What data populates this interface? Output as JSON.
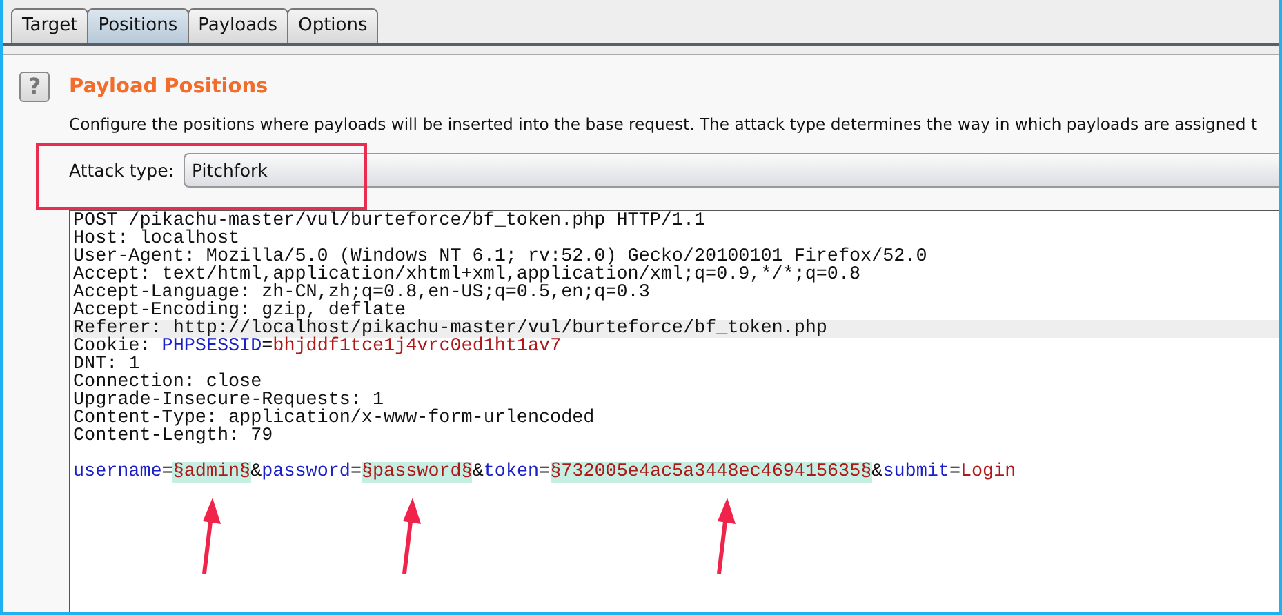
{
  "tabs": [
    {
      "label": "Target",
      "selected": false
    },
    {
      "label": "Positions",
      "selected": true
    },
    {
      "label": "Payloads",
      "selected": false
    },
    {
      "label": "Options",
      "selected": false
    }
  ],
  "help_icon": {
    "glyph": "?"
  },
  "section": {
    "title": "Payload Positions",
    "description": "Configure the positions where payloads will be inserted into the base request. The attack type determines the way in which payloads are assigned t"
  },
  "attack_type": {
    "label": "Attack type:",
    "value": "Pitchfork"
  },
  "request": {
    "headers": [
      {
        "highlighted": false,
        "segments": [
          {
            "kind": "plain",
            "text": "POST /pikachu-master/vul/burteforce/bf_token.php HTTP/1.1"
          }
        ]
      },
      {
        "highlighted": false,
        "segments": [
          {
            "kind": "plain",
            "text": "Host: localhost"
          }
        ]
      },
      {
        "highlighted": false,
        "segments": [
          {
            "kind": "plain",
            "text": "User-Agent: Mozilla/5.0 (Windows NT 6.1; rv:52.0) Gecko/20100101 Firefox/52.0"
          }
        ]
      },
      {
        "highlighted": false,
        "segments": [
          {
            "kind": "plain",
            "text": "Accept: text/html,application/xhtml+xml,application/xml;q=0.9,*/*;q=0.8"
          }
        ]
      },
      {
        "highlighted": false,
        "segments": [
          {
            "kind": "plain",
            "text": "Accept-Language: zh-CN,zh;q=0.8,en-US;q=0.5,en;q=0.3"
          }
        ]
      },
      {
        "highlighted": false,
        "segments": [
          {
            "kind": "plain",
            "text": "Accept-Encoding: gzip, deflate"
          }
        ]
      },
      {
        "highlighted": true,
        "segments": [
          {
            "kind": "plain",
            "text": "Referer: http://localhost/pikachu-master/vul/burteforce/bf_token.php"
          }
        ]
      },
      {
        "highlighted": false,
        "segments": [
          {
            "kind": "plain",
            "text": "Cookie: "
          },
          {
            "kind": "name",
            "text": "PHPSESSID"
          },
          {
            "kind": "plain",
            "text": "="
          },
          {
            "kind": "value",
            "text": "bhjddf1tce1j4vrc0ed1ht1av7"
          }
        ]
      },
      {
        "highlighted": false,
        "segments": [
          {
            "kind": "plain",
            "text": "DNT: 1"
          }
        ]
      },
      {
        "highlighted": false,
        "segments": [
          {
            "kind": "plain",
            "text": "Connection: close"
          }
        ]
      },
      {
        "highlighted": false,
        "segments": [
          {
            "kind": "plain",
            "text": "Upgrade-Insecure-Requests: 1"
          }
        ]
      },
      {
        "highlighted": false,
        "segments": [
          {
            "kind": "plain",
            "text": "Content-Type: application/x-www-form-urlencoded"
          }
        ]
      },
      {
        "highlighted": false,
        "segments": [
          {
            "kind": "plain",
            "text": "Content-Length: 79"
          }
        ]
      }
    ],
    "body": {
      "highlighted": false,
      "segments": [
        {
          "kind": "name",
          "text": "username"
        },
        {
          "kind": "plain",
          "text": "="
        },
        {
          "kind": "payload",
          "text": "§admin§"
        },
        {
          "kind": "plain",
          "text": "&"
        },
        {
          "kind": "name",
          "text": "password"
        },
        {
          "kind": "plain",
          "text": "="
        },
        {
          "kind": "payload",
          "text": "§password§"
        },
        {
          "kind": "plain",
          "text": "&"
        },
        {
          "kind": "name",
          "text": "token"
        },
        {
          "kind": "plain",
          "text": "="
        },
        {
          "kind": "payload",
          "text": "§732005e4ac5a3448ec469415635§"
        },
        {
          "kind": "plain",
          "text": "&"
        },
        {
          "kind": "name",
          "text": "submit"
        },
        {
          "kind": "plain",
          "text": "="
        },
        {
          "kind": "value",
          "text": "Login"
        }
      ]
    }
  }
}
